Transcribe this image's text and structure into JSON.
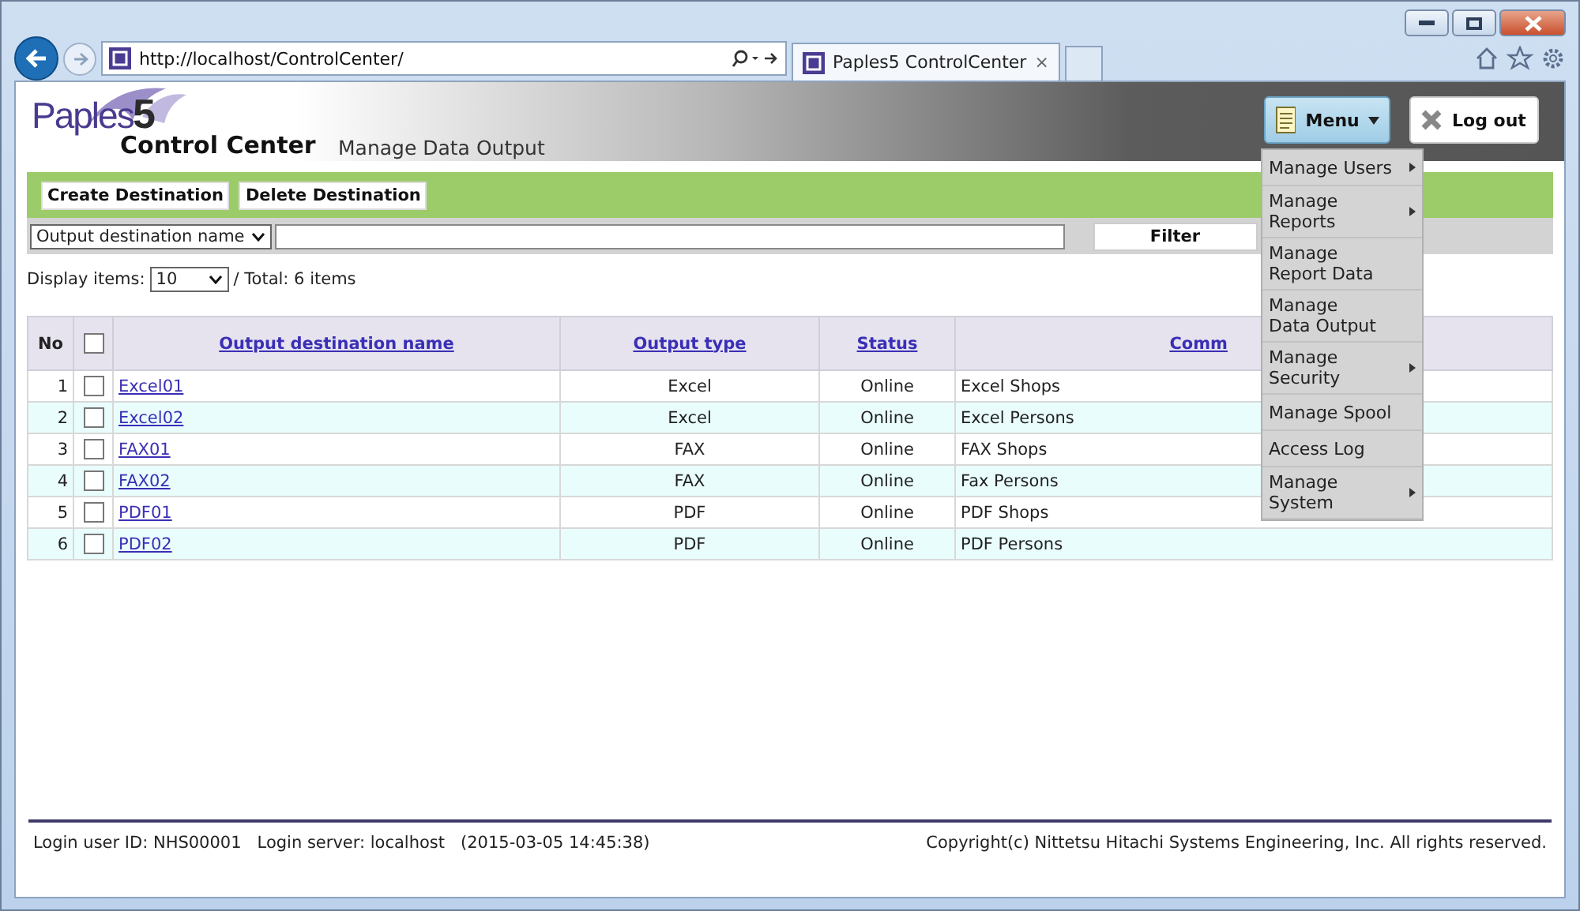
{
  "browser": {
    "url": "http://localhost/ControlCenter/",
    "tab_title": "Paples5 ControlCenter",
    "tab_close": "×"
  },
  "header": {
    "logo_word": "Paples",
    "logo_number": "5",
    "product": "Control Center",
    "page_title": "Manage Data Output",
    "menu_button": "Menu",
    "logout_button": "Log out"
  },
  "menu": [
    {
      "label": "Manage Users",
      "has_submenu": true
    },
    {
      "label": "Manage\nReports",
      "has_submenu": true
    },
    {
      "label": "Manage\nReport Data",
      "has_submenu": false
    },
    {
      "label": "Manage\nData Output",
      "has_submenu": false
    },
    {
      "label": "Manage\nSecurity",
      "has_submenu": true
    },
    {
      "label": "Manage Spool",
      "has_submenu": false
    },
    {
      "label": "Access Log",
      "has_submenu": false
    },
    {
      "label": "Manage\nSystem",
      "has_submenu": true
    }
  ],
  "toolbar": {
    "buttons": [
      "Create Destination",
      "Delete Destination"
    ]
  },
  "filter": {
    "field_select": "Output destination name",
    "filter_button": "Filter"
  },
  "paging": {
    "label": "Display items:",
    "page_size": "10",
    "total": "/ Total: 6 items"
  },
  "table": {
    "columns": [
      {
        "label": "No",
        "kind": "text"
      },
      {
        "kind": "checkbox",
        "checked": false
      },
      {
        "label": "Output destination name",
        "kind": "link"
      },
      {
        "label": "Output type",
        "kind": "link"
      },
      {
        "label": "Status",
        "kind": "link"
      },
      {
        "label": "Comm",
        "kind": "link"
      }
    ],
    "rows": [
      {
        "no": "1",
        "checked": false,
        "name": "Excel01",
        "type": "Excel",
        "status": "Online",
        "comment": "Excel Shops"
      },
      {
        "no": "2",
        "checked": false,
        "name": "Excel02",
        "type": "Excel",
        "status": "Online",
        "comment": "Excel Persons"
      },
      {
        "no": "3",
        "checked": false,
        "name": "FAX01",
        "type": "FAX",
        "status": "Online",
        "comment": "FAX Shops"
      },
      {
        "no": "4",
        "checked": false,
        "name": "FAX02",
        "type": "FAX",
        "status": "Online",
        "comment": "Fax Persons"
      },
      {
        "no": "5",
        "checked": false,
        "name": "PDF01",
        "type": "PDF",
        "status": "Online",
        "comment": "PDF Shops"
      },
      {
        "no": "6",
        "checked": false,
        "name": "PDF02",
        "type": "PDF",
        "status": "Online",
        "comment": "PDF Persons"
      }
    ]
  },
  "footer": {
    "login_info": "Login user ID: NHS00001   Login server: localhost   (2015-03-05 14:45:38)",
    "copyright": "Copyright(c) Nittetsu Hitachi Systems Engineering, Inc. All rights reserved."
  }
}
